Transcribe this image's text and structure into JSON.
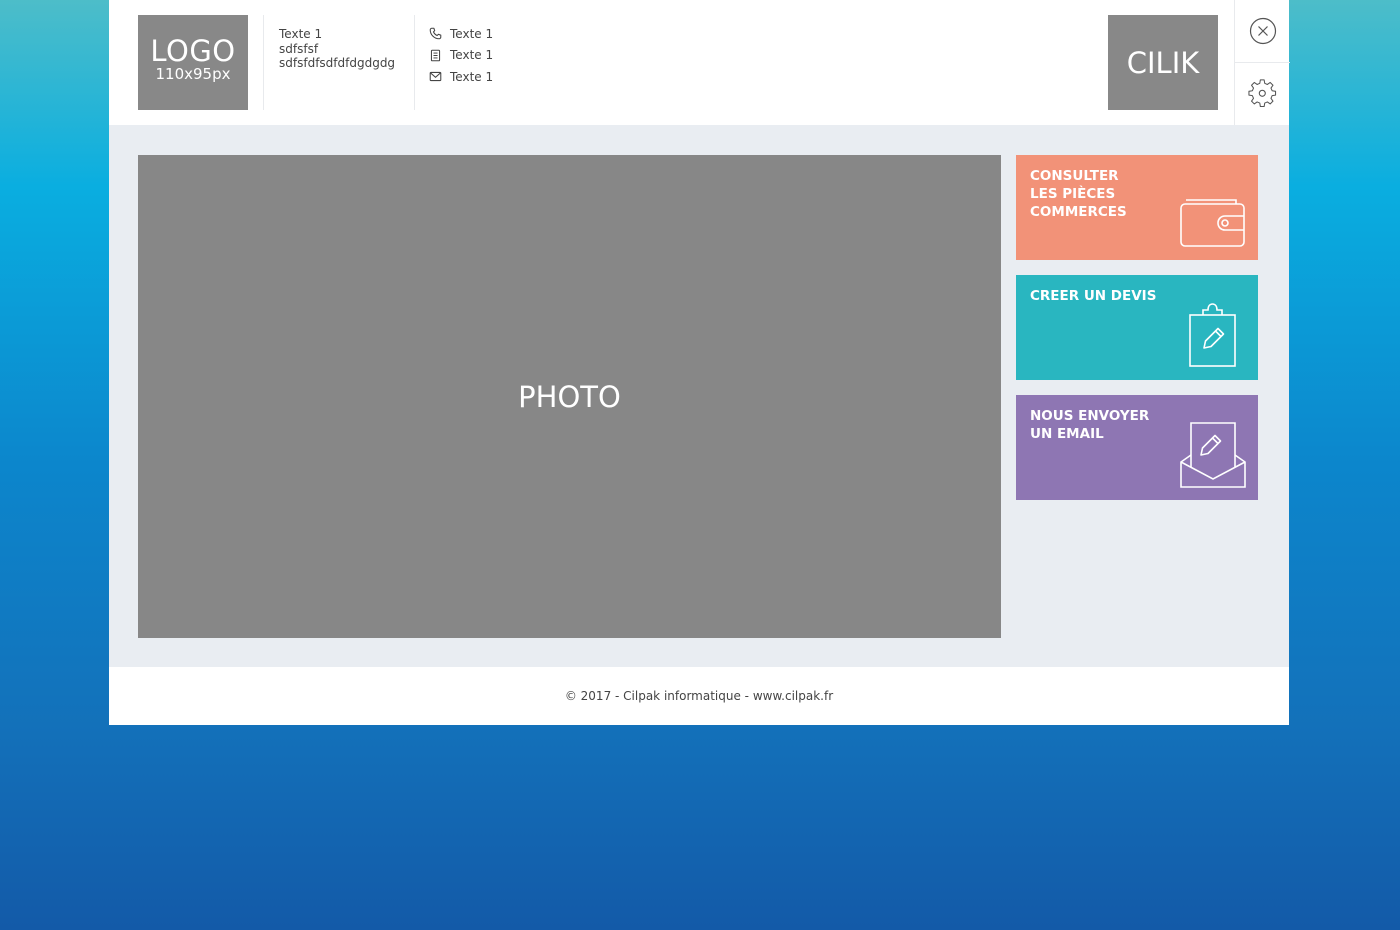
{
  "header": {
    "logo": {
      "main": "LOGO",
      "sub": "110x95px"
    },
    "address": [
      "Texte 1",
      "sdfsfsf",
      "sdfsfdfsdfdfdgdgdg"
    ],
    "contacts": [
      {
        "icon": "phone-icon",
        "text": "Texte 1"
      },
      {
        "icon": "fax-icon",
        "text": "Texte 1"
      },
      {
        "icon": "mail-icon",
        "text": "Texte 1"
      }
    ],
    "brand_button": "CILIK",
    "side_icons": [
      "close-icon",
      "gear-icon"
    ]
  },
  "main": {
    "photo_label": "PHOTO",
    "tiles": [
      {
        "lines": [
          "CONSULTER",
          "LES PIÈCES",
          "COMMERCES"
        ],
        "color": "#f29278",
        "icon": "wallet-icon"
      },
      {
        "lines": [
          "CREER UN DEVIS"
        ],
        "color": "#29b6c0",
        "icon": "clipboard-edit-icon"
      },
      {
        "lines": [
          "NOUS ENVOYER",
          "UN EMAIL"
        ],
        "color": "#8e76b3",
        "icon": "envelope-edit-icon"
      }
    ]
  },
  "footer": {
    "text": "© 2017 - Cilpak informatique - www.cilpak.fr"
  },
  "colors": {
    "placeholder_gray": "#888888",
    "panel_bg": "#e9edf2"
  }
}
